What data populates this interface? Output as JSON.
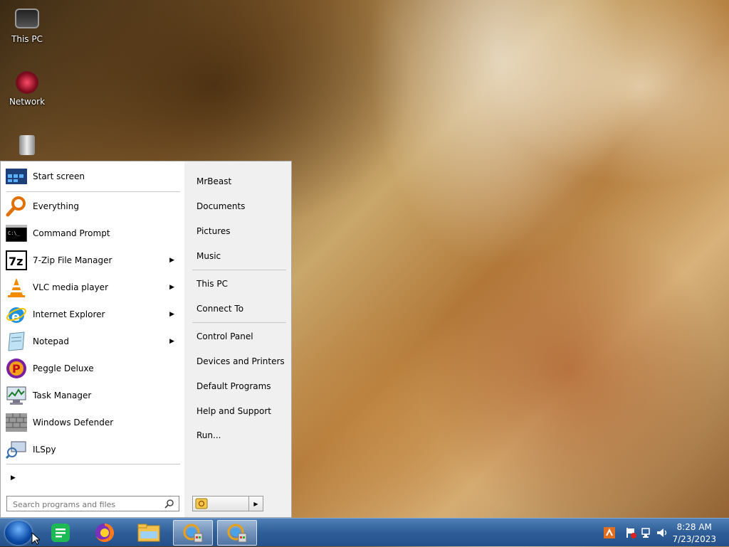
{
  "desktop": {
    "icons": [
      {
        "label": "This PC"
      },
      {
        "label": "Network"
      }
    ]
  },
  "start_menu": {
    "pinned": {
      "label": "Start screen"
    },
    "programs": [
      {
        "label": "Everything",
        "submenu": false
      },
      {
        "label": "Command Prompt",
        "submenu": false
      },
      {
        "label": "7-Zip File Manager",
        "submenu": true
      },
      {
        "label": "VLC media player",
        "submenu": true
      },
      {
        "label": "Internet Explorer",
        "submenu": true
      },
      {
        "label": "Notepad",
        "submenu": true
      },
      {
        "label": "Peggle Deluxe",
        "submenu": false
      },
      {
        "label": "Task Manager",
        "submenu": false
      },
      {
        "label": "Windows Defender",
        "submenu": false
      },
      {
        "label": "ILSpy",
        "submenu": false
      }
    ],
    "search": {
      "placeholder": "Search programs and files"
    },
    "places": [
      {
        "label": "MrBeast"
      },
      {
        "label": "Documents"
      },
      {
        "label": "Pictures"
      },
      {
        "label": "Music"
      },
      {
        "label": "This PC"
      },
      {
        "label": "Connect To"
      },
      {
        "label": "Control Panel"
      },
      {
        "label": "Devices and Printers"
      },
      {
        "label": "Default Programs"
      },
      {
        "label": "Help and Support"
      },
      {
        "label": "Run..."
      }
    ]
  },
  "taskbar": {
    "clock": {
      "time": "8:28 AM",
      "date": "7/23/2023"
    }
  },
  "colors": {
    "taskbar": "#2f5e98",
    "menu_left": "#ffffff",
    "menu_right": "#f0f0f0"
  }
}
